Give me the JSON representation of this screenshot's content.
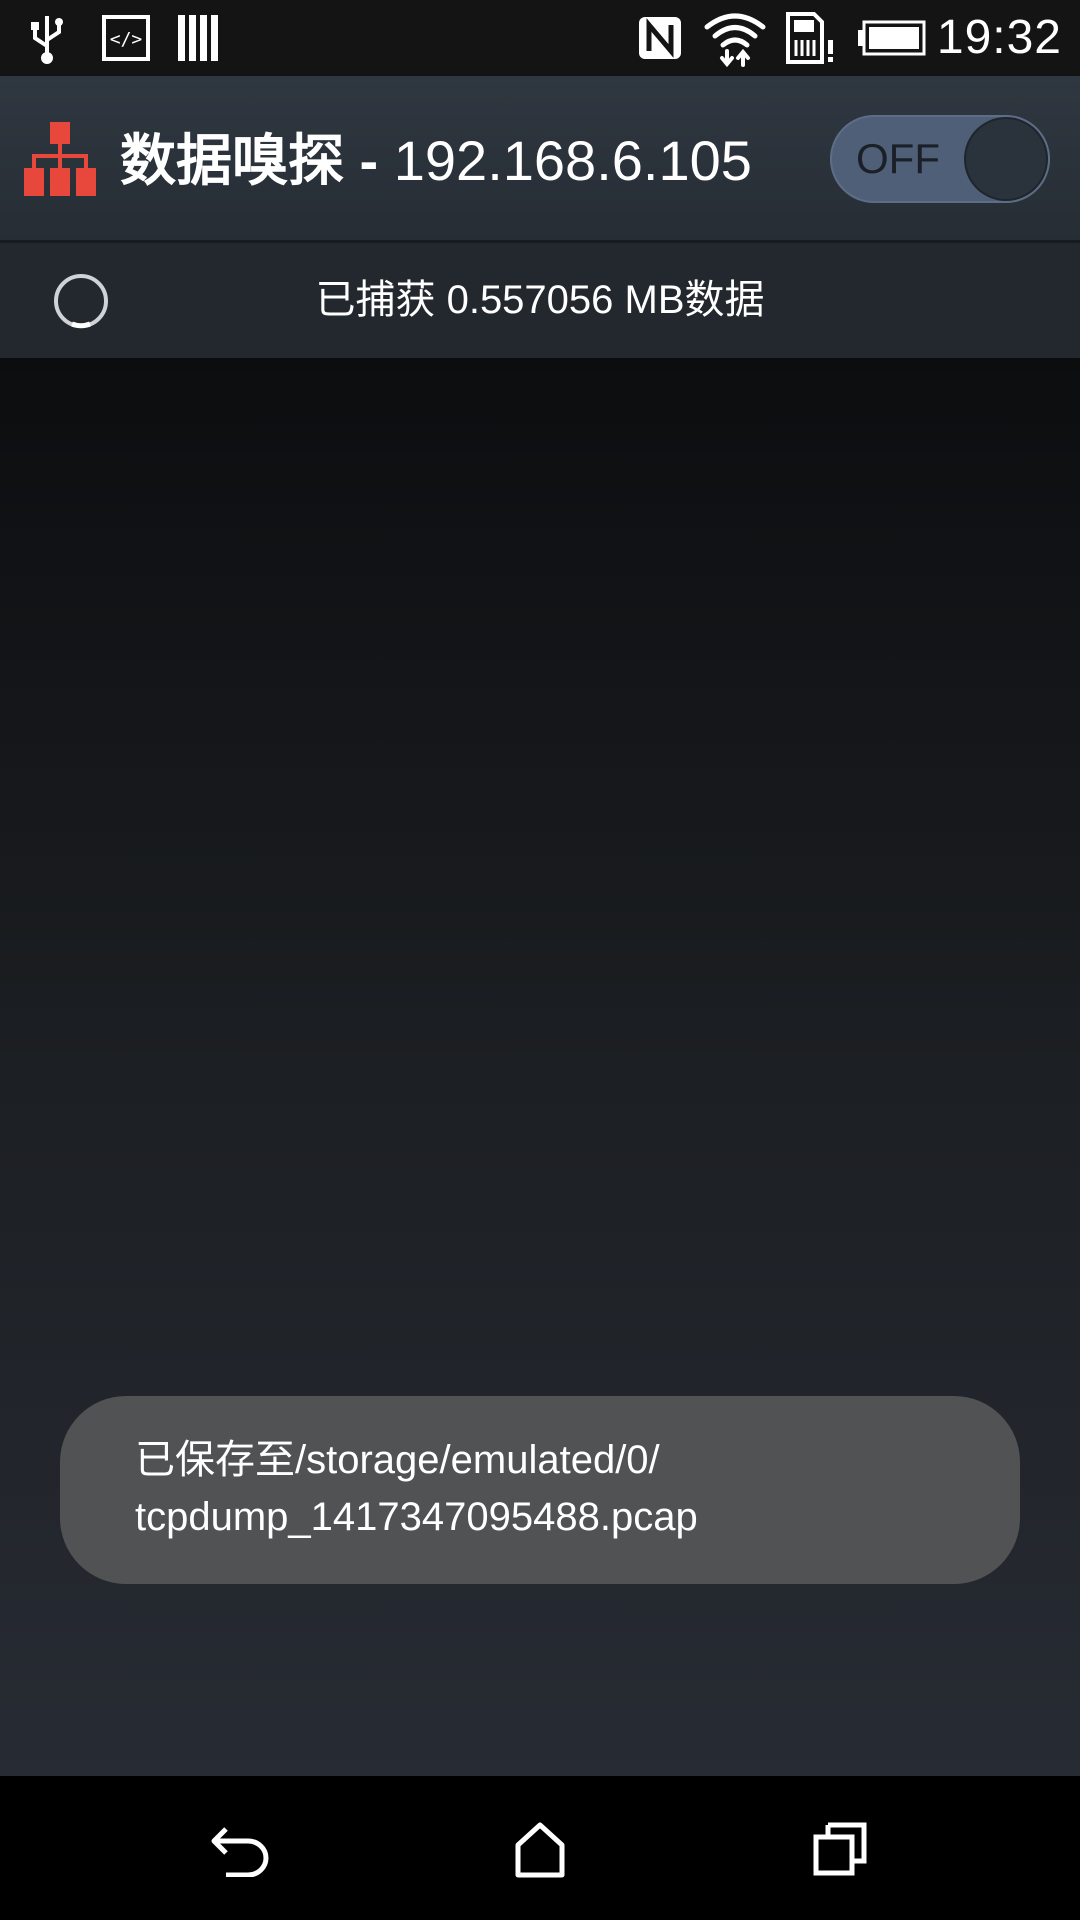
{
  "status_bar": {
    "time": "19:32",
    "icons": [
      "usb-icon",
      "developer-code-icon",
      "barcode-icon",
      "nfc-icon",
      "wifi-icon",
      "sd-card-warning-icon",
      "battery-icon"
    ]
  },
  "action_bar": {
    "app_icon": "network-sitemap-icon",
    "title_name": "数据嗅探",
    "title_separator": " - ",
    "ip_address": "192.168.6.105",
    "toggle_label": "OFF",
    "colors": {
      "app_icon": "#e8473b",
      "toggle_track": "#4f5f78"
    }
  },
  "capture_status": {
    "spinner_icon": "loading-spinner-icon",
    "text": "已捕获 0.557056 MB数据"
  },
  "toast": {
    "line1": "已保存至/storage/emulated/0/",
    "line2": "tcpdump_1417347095488.pcap"
  },
  "nav_bar": {
    "icons": [
      "back-icon",
      "home-icon",
      "recents-icon"
    ]
  }
}
